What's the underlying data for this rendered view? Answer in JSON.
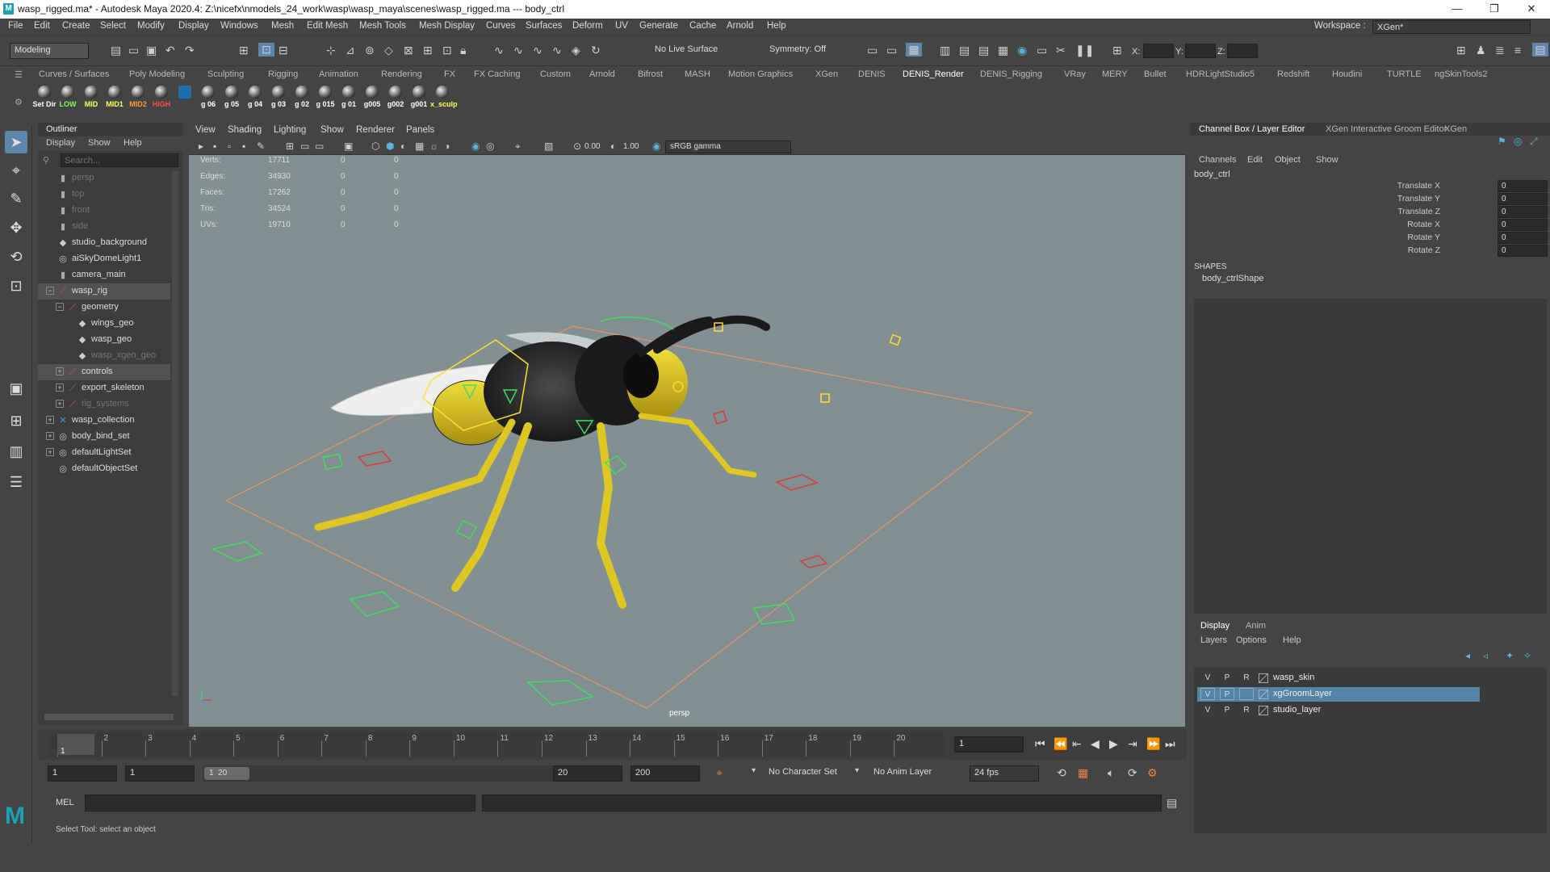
{
  "window": {
    "title": "wasp_rigged.ma* - Autodesk Maya 2020.4: Z:\\nicefx\\nmodels_24_work\\wasp\\wasp_maya\\scenes\\wasp_rigged.ma  ---  body_ctrl",
    "minimize": "—",
    "maximize": "❐",
    "close": "✕"
  },
  "menubar": [
    "File",
    "Edit",
    "Create",
    "Select",
    "Modify",
    "Display",
    "Windows",
    "Mesh",
    "Edit Mesh",
    "Mesh Tools",
    "Mesh Display",
    "Curves",
    "Surfaces",
    "Deform",
    "UV",
    "Generate",
    "Cache",
    "Arnold",
    "Help"
  ],
  "workspace": {
    "label": "Workspace :",
    "value": "XGen*"
  },
  "statusline": {
    "menuset": "Modeling",
    "live_surface": "No Live Surface",
    "symmetry": "Symmetry: Off",
    "x_label": "X:",
    "y_label": "Y:",
    "z_label": "Z:"
  },
  "shelf_tabs": [
    "Curves / Surfaces",
    "Poly Modeling",
    "Sculpting",
    "Rigging",
    "Animation",
    "Rendering",
    "FX",
    "FX Caching",
    "Custom",
    "Arnold",
    "Bifrost",
    "MASH",
    "Motion Graphics",
    "XGen",
    "DENIS",
    "DENIS_Render",
    "DENIS_Rigging",
    "VRay",
    "MERY",
    "Bullet",
    "HDRLightStudio5",
    "Redshift",
    "Houdini",
    "TURTLE",
    "ngSkinTools2"
  ],
  "shelf_active": "DENIS_Render",
  "shelf_buttons": [
    {
      "label": "Set Dir",
      "color": "#ffffff"
    },
    {
      "label": "LOW",
      "color": "#7dff5c"
    },
    {
      "label": "MID",
      "color": "#ffff55"
    },
    {
      "label": "MID1",
      "color": "#ffff55"
    },
    {
      "label": "MID2",
      "color": "#ff9a3a"
    },
    {
      "label": "HIGH",
      "color": "#ff4a4a"
    },
    {
      "label": "",
      "color": "#ffffff"
    },
    {
      "label": "g 06",
      "color": "#ffffff"
    },
    {
      "label": "g 05",
      "color": "#ffffff"
    },
    {
      "label": "g 04",
      "color": "#ffffff"
    },
    {
      "label": "g 03",
      "color": "#ffffff"
    },
    {
      "label": "g 02",
      "color": "#ffffff"
    },
    {
      "label": "g 015",
      "color": "#ffffff"
    },
    {
      "label": "g 01",
      "color": "#ffffff"
    },
    {
      "label": "g005",
      "color": "#ffffff"
    },
    {
      "label": "g002",
      "color": "#ffffff"
    },
    {
      "label": "g001",
      "color": "#ffffff"
    },
    {
      "label": "x_sculp",
      "color": "#ffff55"
    }
  ],
  "outliner": {
    "title": "Outliner",
    "menu": [
      "Display",
      "Show",
      "Help"
    ],
    "search_placeholder": "Search...",
    "items": [
      {
        "label": "persp",
        "icon": "camera-icon",
        "dim": true,
        "indent": 0,
        "expand": ""
      },
      {
        "label": "top",
        "icon": "camera-icon",
        "dim": true,
        "indent": 0,
        "expand": ""
      },
      {
        "label": "front",
        "icon": "camera-icon",
        "dim": true,
        "indent": 0,
        "expand": ""
      },
      {
        "label": "side",
        "icon": "camera-icon",
        "dim": true,
        "indent": 0,
        "expand": ""
      },
      {
        "label": "studio_background",
        "icon": "mesh-icon",
        "dim": false,
        "indent": 0,
        "expand": ""
      },
      {
        "label": "aiSkyDomeLight1",
        "icon": "light-icon",
        "dim": false,
        "indent": 0,
        "expand": ""
      },
      {
        "label": "camera_main",
        "icon": "camera-icon",
        "dim": false,
        "indent": 0,
        "expand": ""
      },
      {
        "label": "wasp_rig",
        "icon": "transform-icon",
        "dim": false,
        "indent": 0,
        "expand": "−",
        "hl": true
      },
      {
        "label": "geometry",
        "icon": "transform-icon",
        "dim": false,
        "indent": 1,
        "expand": "−"
      },
      {
        "label": "wings_geo",
        "icon": "mesh-icon",
        "dim": false,
        "indent": 2,
        "expand": ""
      },
      {
        "label": "wasp_geo",
        "icon": "mesh-icon",
        "dim": false,
        "indent": 2,
        "expand": ""
      },
      {
        "label": "wasp_xgen_geo",
        "icon": "mesh-icon",
        "dim": true,
        "indent": 2,
        "expand": ""
      },
      {
        "label": "controls",
        "icon": "transform-icon",
        "dim": false,
        "indent": 1,
        "expand": "+",
        "hl": true
      },
      {
        "label": "export_skeleton",
        "icon": "transform-icon",
        "dim": false,
        "indent": 1,
        "expand": "+"
      },
      {
        "label": "rig_systems",
        "icon": "transform-icon",
        "dim": true,
        "indent": 1,
        "expand": "+"
      },
      {
        "label": "wasp_collection",
        "icon": "collection-icon",
        "dim": false,
        "indent": 0,
        "expand": "+"
      },
      {
        "label": "body_bind_set",
        "icon": "set-icon",
        "dim": false,
        "indent": 0,
        "expand": "+"
      },
      {
        "label": "defaultLightSet",
        "icon": "set-icon",
        "dim": false,
        "indent": 0,
        "expand": "+"
      },
      {
        "label": "defaultObjectSet",
        "icon": "set-icon",
        "dim": false,
        "indent": 0,
        "expand": ""
      }
    ]
  },
  "viewport": {
    "menu": [
      "View",
      "Shading",
      "Lighting",
      "Show",
      "Renderer",
      "Panels"
    ],
    "near_value": "0.00",
    "gamma_value": "1.00",
    "color_space": "sRGB gamma",
    "camera_label": "persp",
    "hud": [
      {
        "label": "Verts:",
        "c1": "17711",
        "c2": "0",
        "c3": "0"
      },
      {
        "label": "Edges:",
        "c1": "34930",
        "c2": "0",
        "c3": "0"
      },
      {
        "label": "Faces:",
        "c1": "17262",
        "c2": "0",
        "c3": "0"
      },
      {
        "label": "Tris:",
        "c1": "34524",
        "c2": "0",
        "c3": "0"
      },
      {
        "label": "UVs:",
        "c1": "19710",
        "c2": "0",
        "c3": "0"
      }
    ]
  },
  "channelbox": {
    "tabs": [
      "Channel Box / Layer Editor",
      "XGen Interactive Groom Editor",
      "XGen"
    ],
    "menu": [
      "Channels",
      "Edit",
      "Object",
      "Show"
    ],
    "object": "body_ctrl",
    "channels": [
      {
        "label": "Translate X",
        "value": "0"
      },
      {
        "label": "Translate Y",
        "value": "0"
      },
      {
        "label": "Translate Z",
        "value": "0"
      },
      {
        "label": "Rotate X",
        "value": "0"
      },
      {
        "label": "Rotate Y",
        "value": "0"
      },
      {
        "label": "Rotate Z",
        "value": "0"
      }
    ],
    "shapes_header": "SHAPES",
    "shape": "body_ctrlShape"
  },
  "layers": {
    "tabs": [
      "Display",
      "Anim"
    ],
    "menu": [
      "Layers",
      "Options",
      "Help"
    ],
    "rows": [
      {
        "v": "V",
        "p": "P",
        "r": "R",
        "name": "wasp_skin",
        "selected": false
      },
      {
        "v": "V",
        "p": "P",
        "r": "",
        "name": "xgGroomLayer",
        "selected": true
      },
      {
        "v": "V",
        "p": "P",
        "r": "R",
        "name": "studio_layer",
        "selected": false
      }
    ]
  },
  "timeline": {
    "ticks": [
      "1",
      "2",
      "3",
      "4",
      "5",
      "6",
      "7",
      "8",
      "9",
      "10",
      "11",
      "12",
      "13",
      "14",
      "15",
      "16",
      "17",
      "18",
      "19",
      "20"
    ],
    "current_frame": "1",
    "current_field": "1"
  },
  "range": {
    "start": "1",
    "playback_start": "1",
    "range_label": "1  20",
    "playback_end": "20",
    "end": "200",
    "character_set": "No Character Set",
    "anim_layer": "No Anim Layer",
    "fps": "24 fps"
  },
  "command": {
    "label": "MEL"
  },
  "helpline": "Select Tool: select an object"
}
